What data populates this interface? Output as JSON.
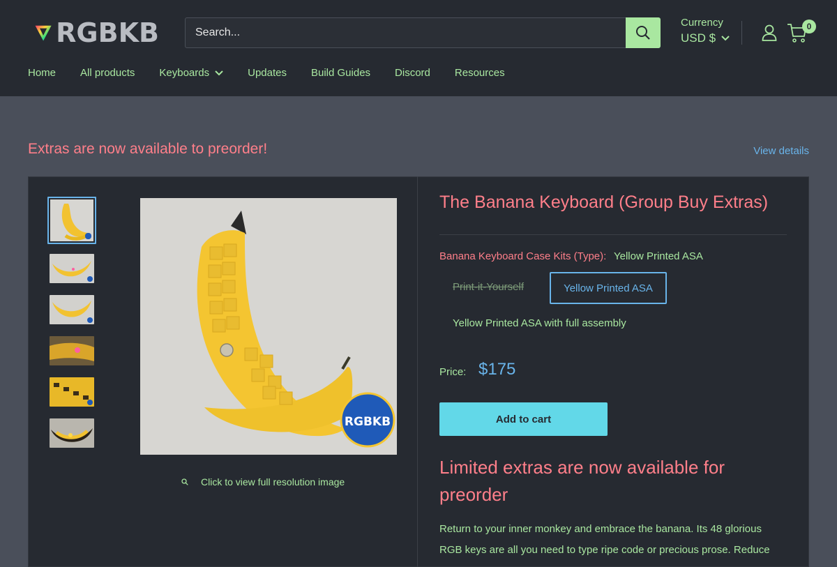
{
  "brand": {
    "logo_text": "RGBKB"
  },
  "search": {
    "placeholder": "Search..."
  },
  "currency": {
    "label": "Currency",
    "value": "USD $"
  },
  "cart": {
    "count": "0"
  },
  "nav": {
    "items": [
      {
        "label": "Home"
      },
      {
        "label": "All products"
      },
      {
        "label": "Keyboards"
      },
      {
        "label": "Updates"
      },
      {
        "label": "Build Guides"
      },
      {
        "label": "Discord"
      },
      {
        "label": "Resources"
      }
    ]
  },
  "announcement": {
    "text": "Extras are now available to preorder!",
    "link": "View details"
  },
  "gallery": {
    "zoom_text": "Click to view full resolution image",
    "badge_text": "RGBKB"
  },
  "product": {
    "title": "The Banana Keyboard (Group Buy Extras)",
    "variant_label": "Banana Keyboard Case Kits (Type):",
    "variant_selected": "Yellow Printed ASA",
    "options": [
      "Print-it-Yourself",
      "Yellow Printed ASA",
      "Yellow Printed ASA with full assembly"
    ],
    "price_label": "Price:",
    "price": "$175",
    "add_to_cart": "Add to cart",
    "promo_heading": "Limited extras are now available for preorder",
    "description": "Return to your inner monkey and embrace the banana. Its 48 glorious RGB keys are all you need to type ripe code or precious prose. Reduce"
  },
  "colors": {
    "header_bg": "#262a31",
    "page_bg": "#4a4f5a",
    "accent_green": "#a9e7a0",
    "accent_pink": "#ff7f8a",
    "accent_blue": "#69b4ea",
    "cart_button": "#62d8e8"
  },
  "icons": [
    "search-icon",
    "chevron-down-icon",
    "user-icon",
    "cart-icon",
    "zoom-icon"
  ]
}
